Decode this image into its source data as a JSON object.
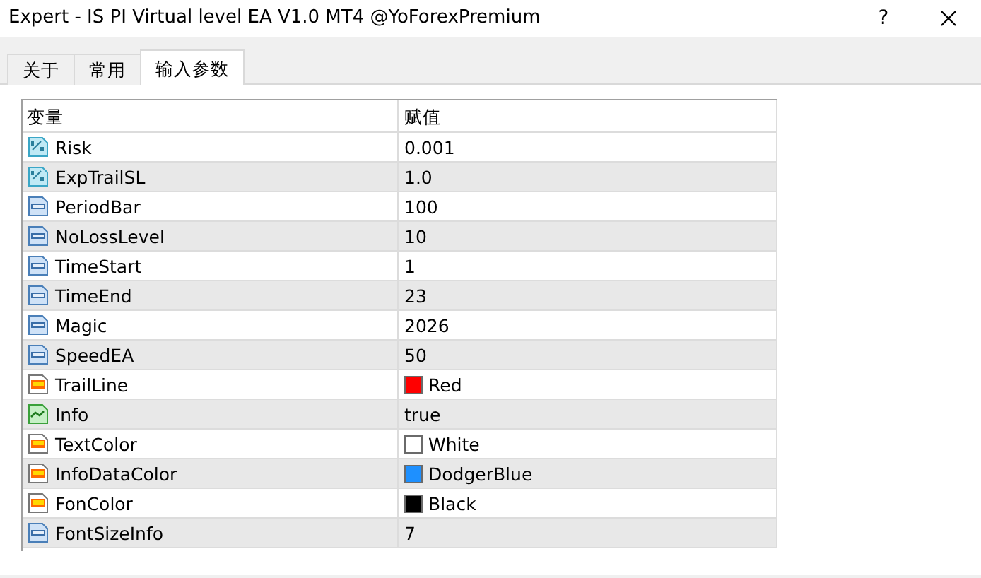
{
  "window": {
    "title": "Expert - IS PI Virtual level EA V1.0 MT4 @YoForexPremium",
    "help": "?"
  },
  "tabs": [
    {
      "label": "关于",
      "selected": false
    },
    {
      "label": "常用",
      "selected": false
    },
    {
      "label": "输入参数",
      "selected": true
    }
  ],
  "table": {
    "columns": [
      "变量",
      "赋值"
    ],
    "rows": [
      {
        "kind": "double",
        "name": "Risk",
        "value": "0.001"
      },
      {
        "kind": "double",
        "name": "ExpTrailSL",
        "value": "1.0"
      },
      {
        "kind": "int",
        "name": "PeriodBar",
        "value": "100"
      },
      {
        "kind": "int",
        "name": "NoLossLevel",
        "value": "10"
      },
      {
        "kind": "int",
        "name": "TimeStart",
        "value": "1"
      },
      {
        "kind": "int",
        "name": "TimeEnd",
        "value": "23"
      },
      {
        "kind": "int",
        "name": "Magic",
        "value": "2026"
      },
      {
        "kind": "int",
        "name": "SpeedEA",
        "value": "50"
      },
      {
        "kind": "color",
        "name": "TrailLine",
        "value": "Red",
        "color": "#ff0000"
      },
      {
        "kind": "bool",
        "name": "Info",
        "value": "true"
      },
      {
        "kind": "color",
        "name": "TextColor",
        "value": "White",
        "color": "#ffffff"
      },
      {
        "kind": "color",
        "name": "InfoDataColor",
        "value": "DodgerBlue",
        "color": "#1e90ff"
      },
      {
        "kind": "color",
        "name": "FonColor",
        "value": "Black",
        "color": "#000000"
      },
      {
        "kind": "int",
        "name": "FontSizeInfo",
        "value": "7"
      }
    ]
  }
}
